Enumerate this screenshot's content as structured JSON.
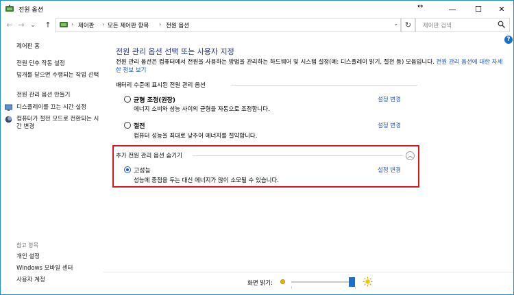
{
  "window": {
    "title": "전원 옵션",
    "minimize": "—",
    "maximize": "☐",
    "close": "✕"
  },
  "nav": {
    "back": "←",
    "forward": "→",
    "recent": "⌄",
    "up": "↑"
  },
  "address": {
    "crumbs": [
      "제어판",
      "모든 제어판 항목",
      "전원 옵션"
    ],
    "separator": "›",
    "refresh": "↻"
  },
  "search": {
    "placeholder": "제어판 검색"
  },
  "help": "?",
  "sidebar": {
    "home": "제어판 홈",
    "links": [
      "전원 단추 작동 설정",
      "덮개를 닫으면 수행되는 작업 선택",
      "전원 관리 옵션 만들기",
      "디스플레이를 끄는 시간 설정",
      "컴퓨터가 절전 모드로 전환되는 시간 변경"
    ],
    "see_also_heading": "참고 항목",
    "see_also": [
      "개인 설정",
      "Windows 모바일 센터",
      "사용자 계정"
    ]
  },
  "main": {
    "title": "전원 관리 옵션 선택 또는 사용자 지정",
    "desc_text": "전원 관리 옵션은 컴퓨터에서 전원을 사용하는 방법을 관리하는 하드웨어 및 시스템 설정(예: 디스플레이 밝기, 절전 등) 모음입니다.",
    "desc_link": "전원 관리 옵션에 대한 자세한 정보 보기",
    "battery_group": "배터리 수준에 표시된 전원 관리 옵션",
    "plans": [
      {
        "name": "균형 조정(권장)",
        "desc": "에너지 소비와 성능 사이의 균형을 자동으로 조정합니다.",
        "link": "설정 변경",
        "selected": false
      },
      {
        "name": "절전",
        "desc": "컴퓨터 성능을 최대로 낮추어 에너지를 절약합니다.",
        "link": "설정 변경",
        "selected": false
      }
    ],
    "extra_group": "추가 전원 관리 옵션 숨기기",
    "collapse_icon": "chevron-up",
    "extra_plans": [
      {
        "name": "고성능",
        "desc": "성능에 중점을 두는 대신 에너지가 많이 소모될 수 있습니다.",
        "link": "설정 변경",
        "selected": true
      }
    ]
  },
  "brightness": {
    "label": "화면 밝기:",
    "level": 0.96
  },
  "colors": {
    "title": "#1e3287",
    "link": "#1a56c9",
    "highlight": "#e0141e",
    "accent": "#1a6fc9"
  }
}
